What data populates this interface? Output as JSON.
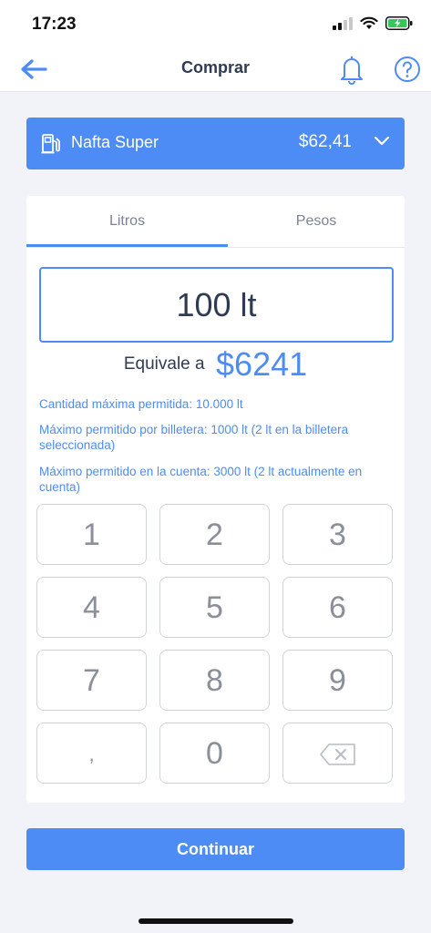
{
  "status_bar": {
    "time": "17:23"
  },
  "header": {
    "title": "Comprar"
  },
  "fuel_selector": {
    "name": "Nafta Super",
    "price": "$62,41"
  },
  "tabs": [
    {
      "label": "Litros",
      "active": true
    },
    {
      "label": "Pesos",
      "active": false
    }
  ],
  "amount": {
    "value": "100 lt"
  },
  "equivalence": {
    "label": "Equivale a",
    "value": "$6241"
  },
  "limits": {
    "max_quantity": "Cantidad máxima permitida: 10.000 lt",
    "max_wallet": "Máximo permitido por billetera: 1000 lt (2 lt en la billetera seleccionada)",
    "max_account": "Máximo permitido en la cuenta: 3000 lt (2 lt actualmente en cuenta)"
  },
  "keypad": {
    "k1": "1",
    "k2": "2",
    "k3": "3",
    "k4": "4",
    "k5": "5",
    "k6": "6",
    "k7": "7",
    "k8": "8",
    "k9": "9",
    "comma": ",",
    "k0": "0"
  },
  "continue_label": "Continuar",
  "colors": {
    "accent": "#4d8cf5",
    "background": "#f1f3f8",
    "text": "#2f3b52"
  }
}
